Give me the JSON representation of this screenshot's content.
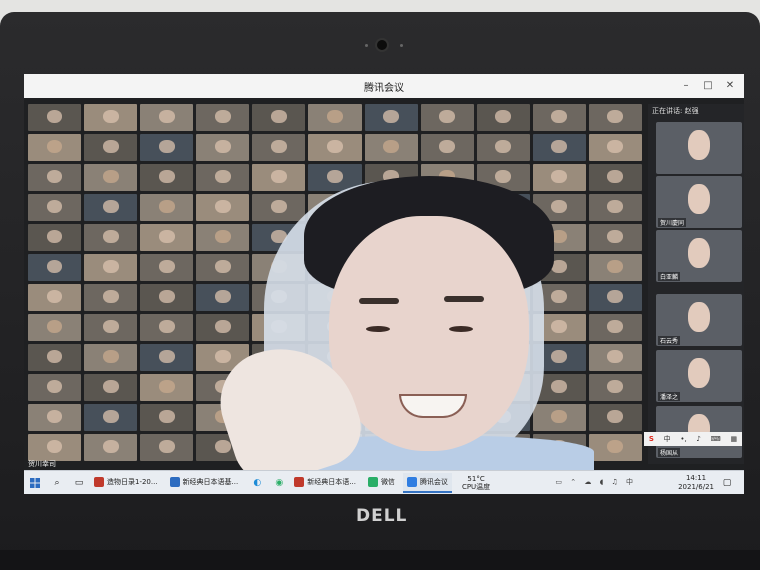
{
  "window": {
    "title": "腾讯会议"
  },
  "side_panel": {
    "header": "正在讲话: 赵强",
    "participants": [
      {
        "name": "贺川慶同"
      },
      {
        "name": "白亚麟"
      },
      {
        "name": "石云秀"
      },
      {
        "name": "潘泽之"
      },
      {
        "name": "杨国从"
      }
    ]
  },
  "speaker_label": "贺川幸司",
  "ime": {
    "label": "中"
  },
  "taskbar": {
    "apps": [
      {
        "label": "造物日录1-20...",
        "color": "#c0392b",
        "active": false
      },
      {
        "label": "新经典日本语基...",
        "color": "#2d6cc0",
        "active": false
      },
      {
        "label": "新经典日本语...",
        "color": "#c0392b",
        "active": false
      },
      {
        "label": "微信",
        "color": "#2aae67",
        "active": false
      },
      {
        "label": "腾讯会议",
        "color": "#2f7de1",
        "active": true
      }
    ],
    "weather_temp": "51°C",
    "weather_label": "CPU温度",
    "time": "14:11",
    "date": "2021/6/21"
  },
  "brand": {
    "logo_text": "DELL"
  },
  "colors": {
    "taskbar_accent": "#3573c2",
    "meeting_bg": "#1f2022"
  },
  "icons": [
    "camera-icon",
    "windows-start-icon",
    "search-icon",
    "task-view-icon",
    "edge-icon",
    "chrome-icon",
    "notification-icon"
  ]
}
